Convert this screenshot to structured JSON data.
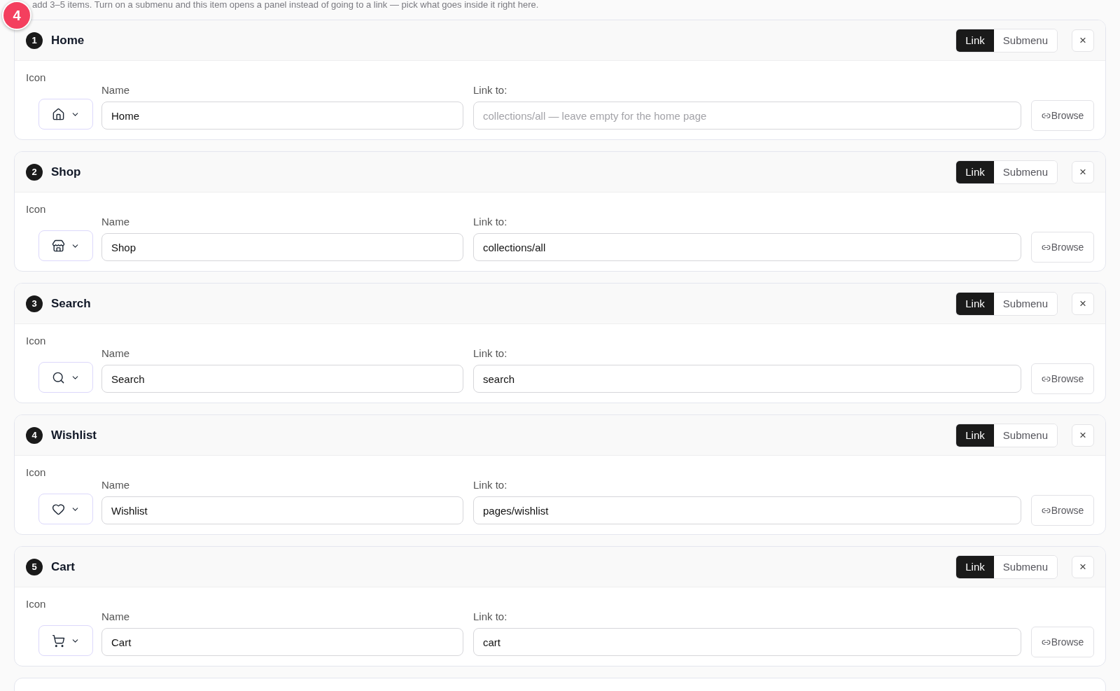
{
  "intro": "add 3–5 items. Turn on a submenu and this item opens a panel instead of going to a link — pick what goes inside it right here.",
  "step_badge": "4",
  "items": [
    {
      "number": "1",
      "title": "Home",
      "modes": [
        {
          "label": "Link",
          "selected": true
        },
        {
          "label": "Submenu",
          "selected": false
        }
      ],
      "remove": "×",
      "icon_label": "Icon",
      "name_label": "Name",
      "name": "Home",
      "link_label": "Link to:",
      "link_placeholder": "collections/all — leave empty for the home page",
      "browse": "Browse"
    },
    {
      "number": "2",
      "title": "Shop",
      "modes": [
        {
          "label": "Link",
          "selected": true
        },
        {
          "label": "Submenu",
          "selected": false
        }
      ],
      "remove": "×",
      "icon_label": "Icon",
      "name_label": "Name",
      "name": "Shop",
      "link_label": "Link to:",
      "link": "collections/all",
      "browse": "Browse"
    },
    {
      "number": "3",
      "title": "Search",
      "modes": [
        {
          "label": "Link",
          "selected": true
        },
        {
          "label": "Submenu",
          "selected": false
        }
      ],
      "remove": "×",
      "icon_label": "Icon",
      "name_label": "Name",
      "name": "Search",
      "link_label": "Link to:",
      "link": "search",
      "browse": "Browse"
    },
    {
      "number": "4",
      "title": "Wishlist",
      "modes": [
        {
          "label": "Link",
          "selected": true
        },
        {
          "label": "Submenu",
          "selected": false
        }
      ],
      "remove": "×",
      "icon_label": "Icon",
      "name_label": "Name",
      "name": "Wishlist",
      "link_label": "Link to:",
      "link": "pages/wishlist",
      "browse": "Browse"
    },
    {
      "number": "5",
      "title": "Cart",
      "modes": [
        {
          "label": "Link",
          "selected": true
        },
        {
          "label": "Submenu",
          "selected": false
        }
      ],
      "remove": "×",
      "icon_label": "Icon",
      "name_label": "Name",
      "name": "Cart",
      "link_label": "Link to:",
      "link": "cart",
      "browse": "Browse"
    }
  ]
}
